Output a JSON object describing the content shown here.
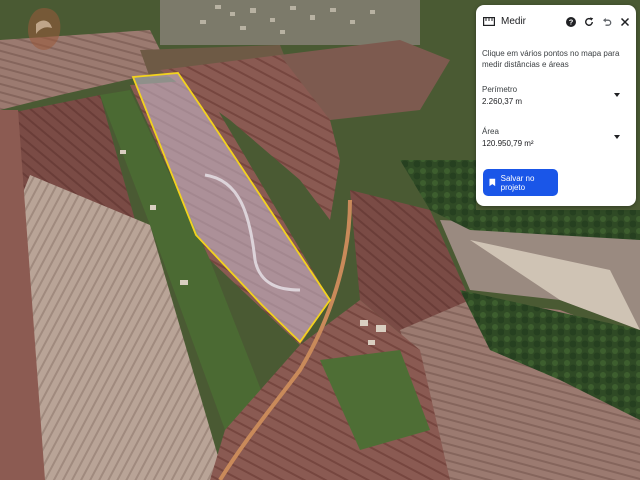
{
  "measure_panel": {
    "title": "Medir",
    "instruction": "Clique em vários pontos no mapa para medir distâncias e áreas",
    "perimeter_label": "Perímetro",
    "perimeter_value": "2.260,37 m",
    "area_label": "Área",
    "area_value": "120.950,79 m²",
    "save_label": "Salvar no projeto"
  },
  "icons": {
    "ruler": "ruler-icon",
    "help": "help-icon",
    "refresh": "refresh-icon",
    "undo": "undo-icon",
    "close": "close-icon",
    "chevron": "chevron-down-icon",
    "bookmark": "bookmark-icon",
    "logo": "logo-watermark-icon"
  },
  "colors": {
    "accent": "#1a56e8",
    "measure_outline": "#f2d21e"
  }
}
